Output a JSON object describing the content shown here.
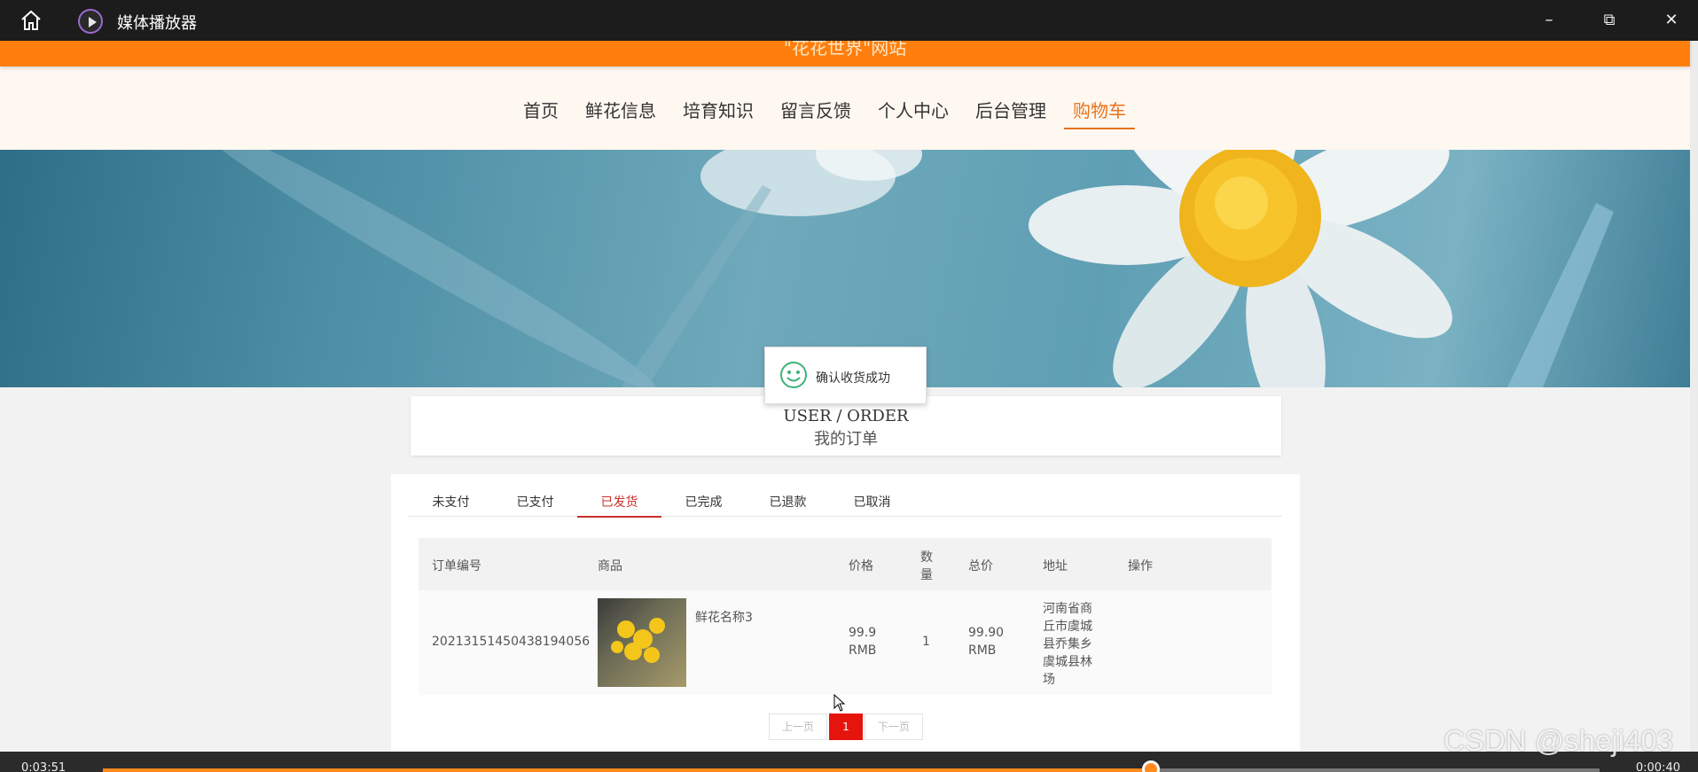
{
  "player": {
    "title": "媒体播放器",
    "time_elapsed": "0:03:51",
    "time_remaining": "0:00:40",
    "progress_fraction": 0.7,
    "accent_color": "#ff8a1e"
  },
  "site": {
    "name": "\"花花世界\"网站",
    "brand_color": "#ff7f0e",
    "nav": [
      "首页",
      "鲜花信息",
      "培育知识",
      "留言反馈",
      "个人中心",
      "后台管理",
      "购物车"
    ],
    "nav_active_index": 6
  },
  "toast": {
    "message": "确认收货成功",
    "icon": "smile-icon"
  },
  "page": {
    "title_en": "USER / ORDER",
    "title_zh": "我的订单"
  },
  "tabs": [
    "未支付",
    "已支付",
    "已发货",
    "已完成",
    "已退款",
    "已取消"
  ],
  "tabs_active_index": 2,
  "table": {
    "headers": {
      "order_no": "订单编号",
      "goods": "商品",
      "price": "价格",
      "qty_line1": "数",
      "qty_line2": "量",
      "total": "总价",
      "address": "地址",
      "action": "操作"
    },
    "rows": [
      {
        "order_no": "20213151450438194056",
        "goods_name": "鲜花名称3",
        "price_value": "99.9",
        "price_unit": "RMB",
        "qty": "1",
        "total_value": "99.90",
        "total_unit": "RMB",
        "address_lines": [
          "河南省商",
          "丘市虞城",
          "县乔集乡",
          "虞城县林",
          "场"
        ]
      }
    ]
  },
  "pager": {
    "prev": "上一页",
    "current": "1",
    "next": "下一页"
  },
  "watermark": "CSDN @sheji403"
}
